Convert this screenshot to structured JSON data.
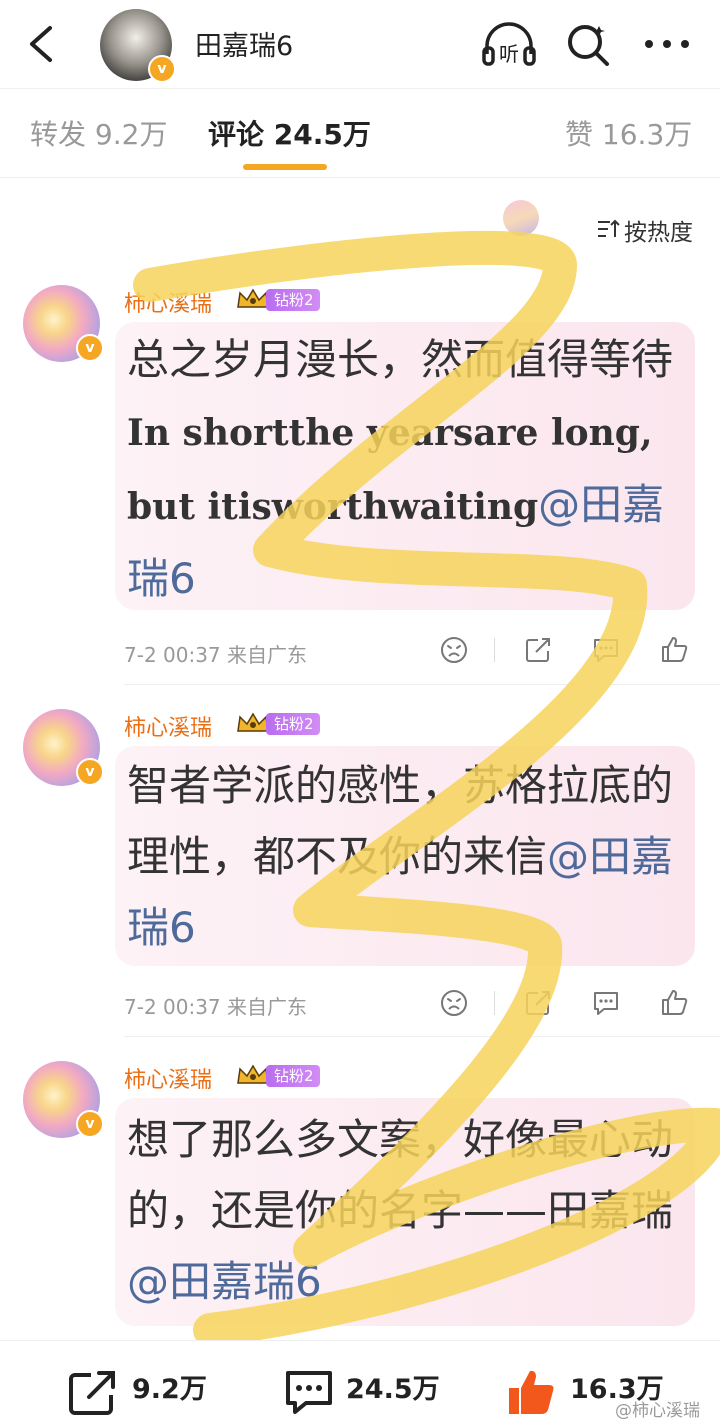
{
  "header": {
    "title": "田嘉瑞6"
  },
  "tabs": [
    {
      "label": "转发",
      "count": "9.2万"
    },
    {
      "label": "评论",
      "count": "24.5万"
    },
    {
      "label": "赞",
      "count": "16.3万"
    }
  ],
  "sort_label": "按热度",
  "comments": [
    {
      "user": "柿心溪瑞",
      "fan_badge": "钻粉2",
      "text_cn": "总之岁月漫长，然而值得等待",
      "text_en": "In shortthe yearsare long, but itisworthwaiting",
      "mention": "@田嘉瑞6",
      "meta": "7-2 00:37  来自广东"
    },
    {
      "user": "柿心溪瑞",
      "fan_badge": "钻粉2",
      "text_cn": "智者学派的感性，苏格拉底的理性，都不及你的来信",
      "mention": "@田嘉瑞6",
      "meta": "7-2 00:37  来自广东"
    },
    {
      "user": "柿心溪瑞",
      "fan_badge": "钻粉2",
      "text_cn": "想了那么多文案，好像最心动的，还是你的名字——田嘉瑞",
      "mention": "@田嘉瑞6"
    }
  ],
  "bottom": {
    "repost": "9.2万",
    "comment": "24.5万",
    "like": "16.3万"
  },
  "watermark": "@柿心溪瑞",
  "colors": {
    "accent": "#f5a623",
    "username": "#ea6f16",
    "mention": "#4e6a9b",
    "like": "#f2571b",
    "scribble": "#f6d35a"
  },
  "icons": [
    "back-arrow-icon",
    "headphone-listen-icon",
    "search-icon",
    "more-icon",
    "sort-icon",
    "dislike-face-icon",
    "share-icon",
    "comment-icon",
    "thumb-up-icon",
    "crown-icon",
    "verified-icon"
  ]
}
